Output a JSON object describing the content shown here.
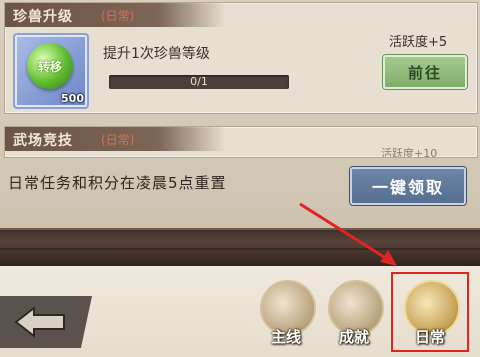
{
  "task1": {
    "title": "珍兽升级",
    "tag": "(日常)",
    "description": "提升1次珍兽等级",
    "progress_text": "0/1",
    "progress_fraction": 0.0,
    "reward": "活跃度+5",
    "go_label": "前往",
    "item_label": "转移",
    "item_count": "500"
  },
  "task2": {
    "title": "武场竞技",
    "tag": "(日常)",
    "reward_partial": "活跃度+10"
  },
  "footer": {
    "reset_note": "日常任务和积分在凌晨5点重置",
    "claim_all_label": "一键领取"
  },
  "nav": {
    "main_label": "主线",
    "achievement_label": "成就",
    "daily_label": "日常",
    "achievement_icon_text": "成就"
  },
  "colors": {
    "highlight": "#e02424",
    "go_button": "#8fba78",
    "claim_button": "#6078a0"
  }
}
